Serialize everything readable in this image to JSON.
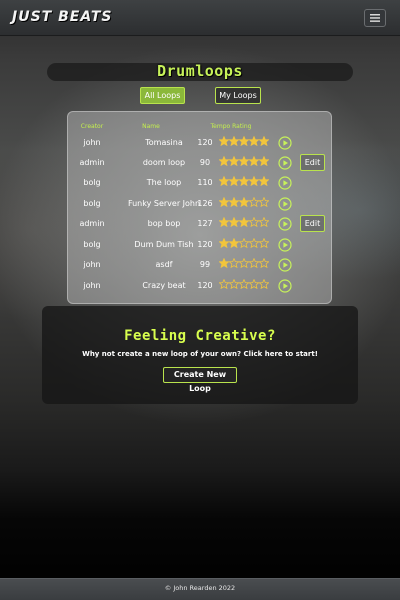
{
  "navbar": {
    "brand": "JUST BEATS",
    "menu_icon": "hamburger-menu-icon"
  },
  "page": {
    "title": "Drumloops",
    "filters": {
      "all": "All Loops",
      "mine": "My Loops",
      "active": "all"
    }
  },
  "table": {
    "headers": {
      "creator": "Creator",
      "name": "Name",
      "tempo_rating": "Tempo Rating"
    },
    "edit_label": "Edit",
    "play_icon": "play-circle-icon",
    "star_icon": "star-icon",
    "rows": [
      {
        "creator": "john",
        "name": "Tomasina",
        "tempo": "120",
        "rating": 5,
        "editable": false
      },
      {
        "creator": "admin",
        "name": "doom loop",
        "tempo": "90",
        "rating": 5,
        "editable": true
      },
      {
        "creator": "bolg",
        "name": "The loop",
        "tempo": "110",
        "rating": 5,
        "editable": false
      },
      {
        "creator": "bolg",
        "name": "Funky Server John",
        "tempo": "126",
        "rating": 3,
        "editable": false
      },
      {
        "creator": "admin",
        "name": "bop bop",
        "tempo": "127",
        "rating": 3,
        "editable": true
      },
      {
        "creator": "bolg",
        "name": "Dum Dum Tish",
        "tempo": "120",
        "rating": 2,
        "editable": false
      },
      {
        "creator": "john",
        "name": "asdf",
        "tempo": "99",
        "rating": 1,
        "editable": false
      },
      {
        "creator": "john",
        "name": "Crazy beat",
        "tempo": "120",
        "rating": 0,
        "editable": false
      }
    ]
  },
  "cta": {
    "title": "Feeling Creative?",
    "text": "Why not create a new loop of your own? Click here to start!",
    "button": "Create New Loop"
  },
  "footer": {
    "text": "© John Rearden 2022"
  },
  "colors": {
    "accent": "#c7f25a",
    "star": "#f2c53d",
    "active_button": "#8bb83a"
  }
}
